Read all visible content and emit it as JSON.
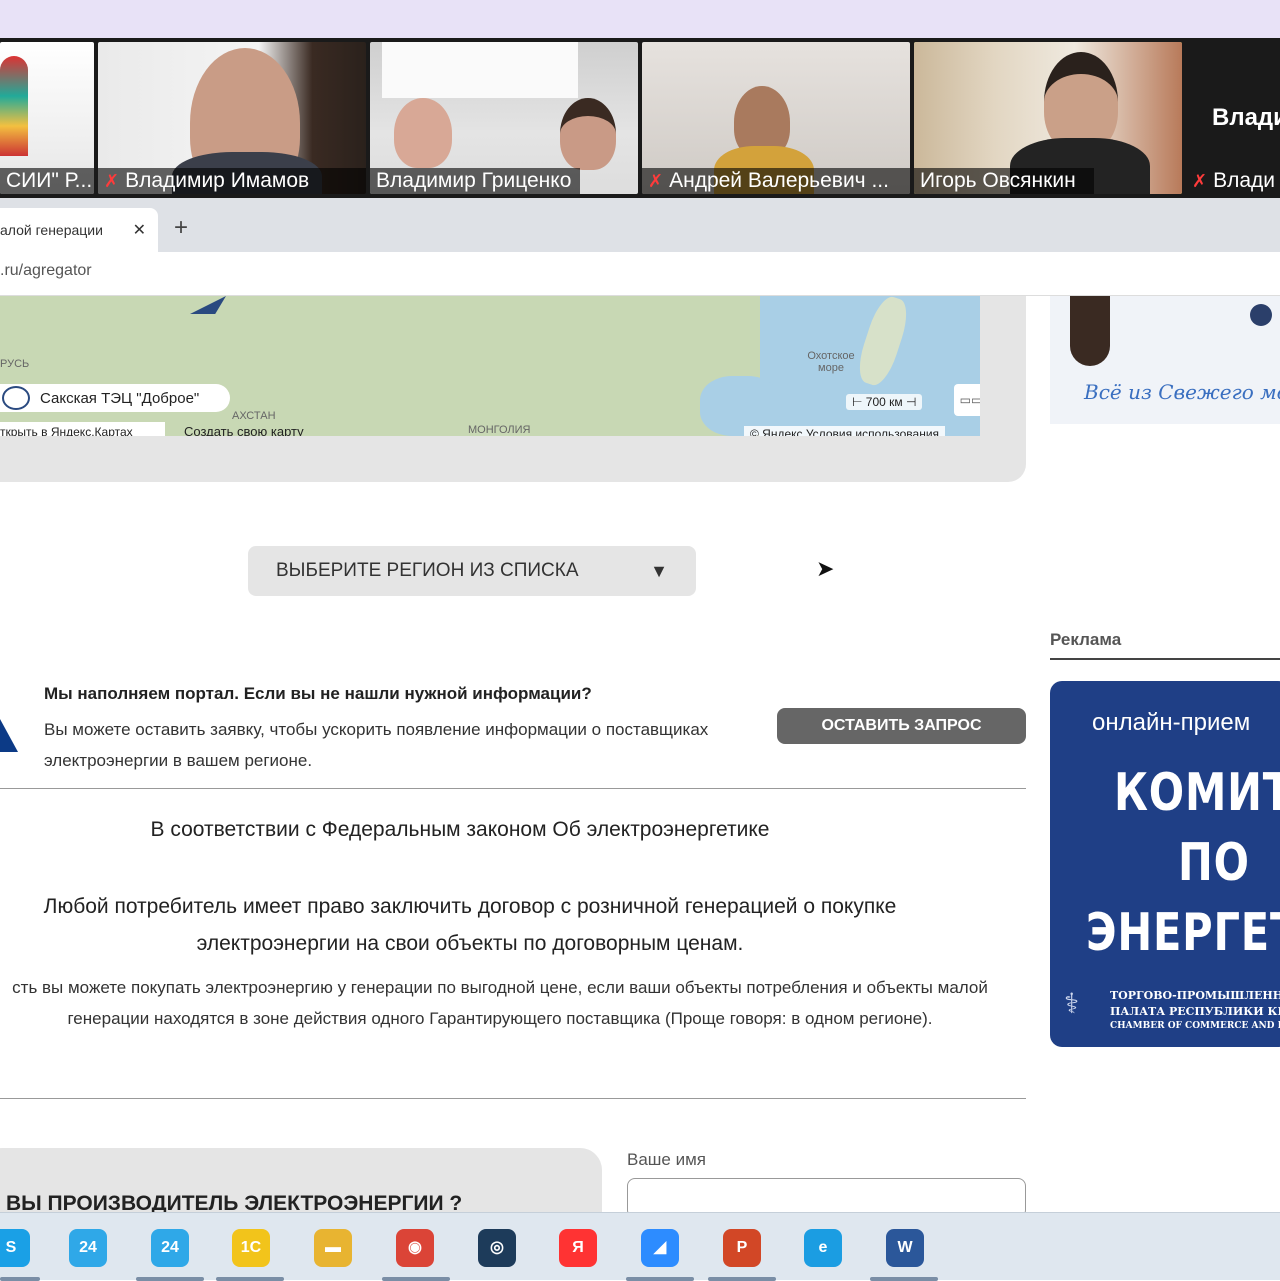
{
  "video": {
    "participants": [
      {
        "name": "СИИ\" Р...",
        "muted": false
      },
      {
        "name": "Владимир Имамов",
        "muted": true
      },
      {
        "name": "Владимир Гриценко",
        "muted": false
      },
      {
        "name": "Андрей Валерьевич ...",
        "muted": true
      },
      {
        "name": "Игорь Овсянкин",
        "muted": false,
        "active": true
      },
      {
        "name": "Влади",
        "muted": true,
        "big_label": "Влади"
      }
    ]
  },
  "browser": {
    "tab_title": "алой генерации",
    "close_glyph": "✕",
    "new_tab_glyph": "+",
    "url": ".ru/agregator"
  },
  "map": {
    "labels": [
      "РУСЬ",
      "АХСТАН",
      "МОНГОЛИЯ",
      "Охотское море"
    ],
    "object_name": "Сакская ТЭЦ \"Доброе\"",
    "open_link": "ткрыть в Яндекс.Картах",
    "create_link": "Создать свою карту",
    "scale": "700 км",
    "copyright": "© Яндекс Условия использования"
  },
  "region_select": {
    "label": "ВЫБЕРИТЕ РЕГИОН ИЗ СПИСКА",
    "arrow": "▼"
  },
  "notice": {
    "title": "Мы наполняем портал. Если вы не нашли нужной информации?",
    "text": "Вы можете оставить заявку, чтобы ускорить появление информации о поставщиках электроэнергии в вашем регионе.",
    "button": "ОСТАВИТЬ ЗАПРОС"
  },
  "law": {
    "title": "В соответствии с Федеральным законом Об электроэнергетике",
    "main": "Любой потребитель имеет право заключить договор с розничной генерацией о покупке электроэнергии на свои объекты по договорным ценам.",
    "sub": "сть вы можете покупать электроэнергию у генерации по выгодной цене, если ваши объекты потребления и объекты малой генерации находятся в зоне действия одного Гарантирующего поставщика (Проще говоря: в одном регионе)."
  },
  "producer": {
    "title": "ВЫ ПРОИЗВОДИТЕЛЬ ЭЛЕКТРОЭНЕРГИИ ?",
    "name_label": "Ваше имя"
  },
  "sidebar": {
    "top_banner_text": "Всё из Свежего мо",
    "ads_label": "Реклама",
    "ad": {
      "subtitle": "онлайн-прием",
      "line1": "КОМИТЕТ",
      "line2": "ПО",
      "line3": "ЭНЕРГЕТИ",
      "foot1": "ТОРГОВО-ПРОМЫШЛЕНН",
      "foot2": "ПАЛАТА РЕСПУБЛИКИ КРЫ",
      "foot3": "CHAMBER OF COMMERCE AND INDU"
    }
  },
  "taskbar": {
    "icons": [
      {
        "name": "skype-icon",
        "label": "S",
        "color": "#1aa0e6"
      },
      {
        "name": "bitrix24-icon",
        "label": "24",
        "color": "#2fa8e8"
      },
      {
        "name": "bitrix24-icon-2",
        "label": "24",
        "color": "#2fa8e8"
      },
      {
        "name": "1c-icon",
        "label": "1С",
        "color": "#f2c41b"
      },
      {
        "name": "file-explorer-icon",
        "label": "▬",
        "color": "#e8b431"
      },
      {
        "name": "chrome-icon",
        "label": "◉",
        "color": "#db4437"
      },
      {
        "name": "camera-app-icon",
        "label": "◎",
        "color": "#1d3b5a"
      },
      {
        "name": "yandex-browser-icon",
        "label": "Я",
        "color": "#f33"
      },
      {
        "name": "zoom-icon",
        "label": "◢",
        "color": "#2d8cff"
      },
      {
        "name": "powerpoint-icon",
        "label": "P",
        "color": "#d24726"
      },
      {
        "name": "edge-icon",
        "label": "e",
        "color": "#1b9de2"
      },
      {
        "name": "word-icon",
        "label": "W",
        "color": "#2b579a"
      }
    ]
  }
}
